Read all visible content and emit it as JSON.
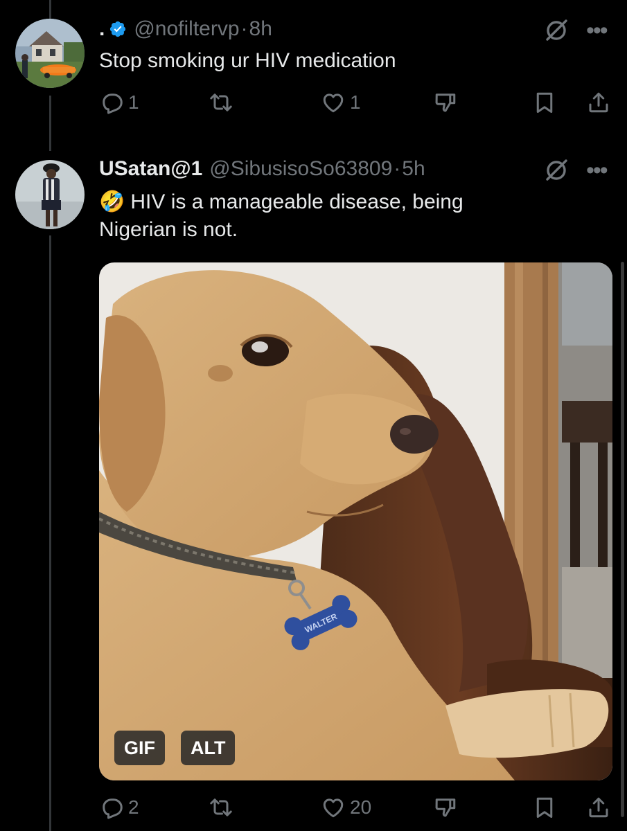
{
  "tweets": [
    {
      "display_name": ".",
      "verified": true,
      "handle": "@nofiltervp",
      "separator": "·",
      "time": "8h",
      "text": "Stop smoking ur HIV medication",
      "actions": {
        "replies": "1",
        "reposts": "",
        "likes": "1"
      }
    },
    {
      "display_name": "USatan@1",
      "verified": false,
      "handle": "@SibusisoSo63809",
      "separator": "·",
      "time": "5h",
      "emoji": "🤣",
      "text_line1": "HIV is a manageable disease, being",
      "text_line2": "Nigerian is not.",
      "media": {
        "badge_gif": "GIF",
        "badge_alt": "ALT",
        "tag_text": "WALTER"
      },
      "actions": {
        "replies": "2",
        "reposts": "",
        "likes": "20"
      }
    }
  ],
  "icons": {
    "verified": "verified-badge-icon",
    "grok": "grok-icon",
    "more": "more-icon",
    "reply": "reply-icon",
    "repost": "repost-icon",
    "like": "like-icon",
    "dislike": "dislike-icon",
    "bookmark": "bookmark-icon",
    "share": "share-icon"
  },
  "colors": {
    "background": "#000000",
    "text_primary": "#e7e9ea",
    "text_secondary": "#71767b",
    "verified_blue": "#1d9bf0",
    "thread_line": "#333639"
  }
}
